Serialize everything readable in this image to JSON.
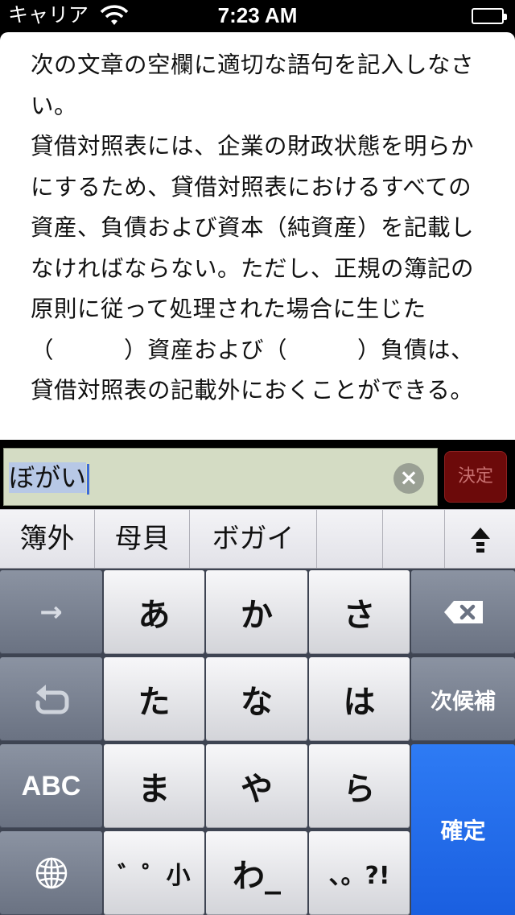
{
  "status_bar": {
    "carrier": "キャリア",
    "time": "7:23 AM"
  },
  "question": {
    "text": "次の文章の空欄に適切な語句を記入しなさい。\n貸借対照表には、企業の財政状態を明らかにするため、貸借対照表におけるすべての資産、負債および資本（純資産）を記載しなければならない。ただし、正規の簿記の原則に従って処理された場合に生じた（　　　）資産および（　　　）負債は、貸借対照表の記載外におくことができる。"
  },
  "answer": {
    "value": "ぼがい",
    "decide_label": "決定"
  },
  "candidates": [
    {
      "label": "簿外"
    },
    {
      "label": "母貝"
    },
    {
      "label": "ボガイ"
    },
    {
      "label": ""
    },
    {
      "label": ""
    }
  ],
  "keyboard": {
    "arrow": "→",
    "a": "あ",
    "ka": "か",
    "sa": "さ",
    "ta": "た",
    "na": "な",
    "ha": "は",
    "next_candidate": "次候補",
    "abc": "ABC",
    "ma": "ま",
    "ya": "や",
    "ra": "ら",
    "confirm": "確定",
    "dakuten": "゛゜小",
    "wa": "わ_",
    "punct": "、。?!"
  }
}
